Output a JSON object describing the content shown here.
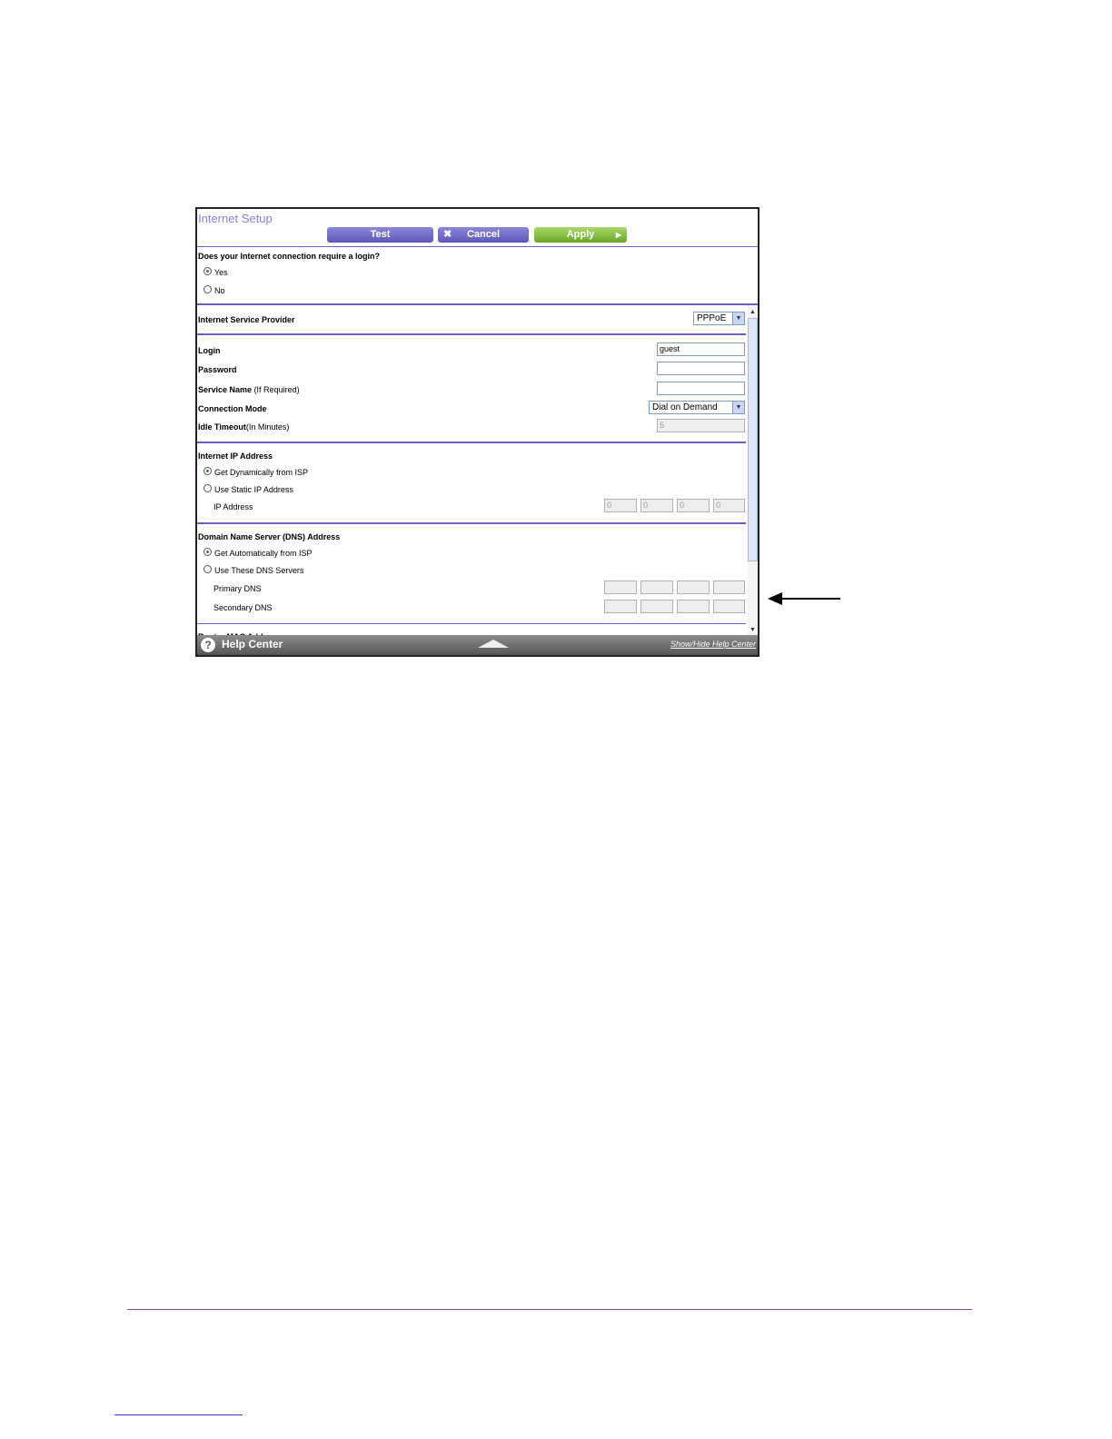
{
  "page": {
    "title": "Internet Setup",
    "buttons": {
      "test": "Test",
      "cancel": "Cancel",
      "apply": "Apply"
    }
  },
  "login_required": {
    "question": "Does your Internet connection require a login?",
    "options": [
      "Yes",
      "No"
    ],
    "selected": "Yes"
  },
  "isp": {
    "label": "Internet Service Provider",
    "value": "PPPoE"
  },
  "fields": {
    "login": {
      "label": "Login",
      "value": "guest"
    },
    "password": {
      "label": "Password",
      "value": ""
    },
    "service_name": {
      "label": "Service Name",
      "hint": "(If Required)",
      "value": ""
    },
    "connection_mode": {
      "label": "Connection Mode",
      "value": "Dial on Demand"
    },
    "idle_timeout": {
      "label": "Idle Timeout",
      "hint": "(In Minutes)",
      "value": "5"
    }
  },
  "ip_address": {
    "heading": "Internet IP Address",
    "options": [
      "Get Dynamically from ISP",
      "Use Static IP Address"
    ],
    "selected": "Get Dynamically from ISP",
    "ip_label": "IP Address",
    "octets": [
      "0",
      "0",
      "0",
      "0"
    ]
  },
  "dns": {
    "heading": "Domain Name Server (DNS) Address",
    "options": [
      "Get Automatically from ISP",
      "Use These DNS Servers"
    ],
    "selected": "Get Automatically from ISP",
    "primary_label": "Primary DNS",
    "secondary_label": "Secondary DNS"
  },
  "cut_off_heading": "Router MAC Address",
  "help_bar": {
    "title": "Help Center",
    "toggle_link": "Show/Hide Help Center",
    "icon": "question-icon"
  },
  "colors": {
    "accent": "#6b5fc4",
    "apply_green": "#7ab83a",
    "button_purple": "#6f69c6"
  }
}
